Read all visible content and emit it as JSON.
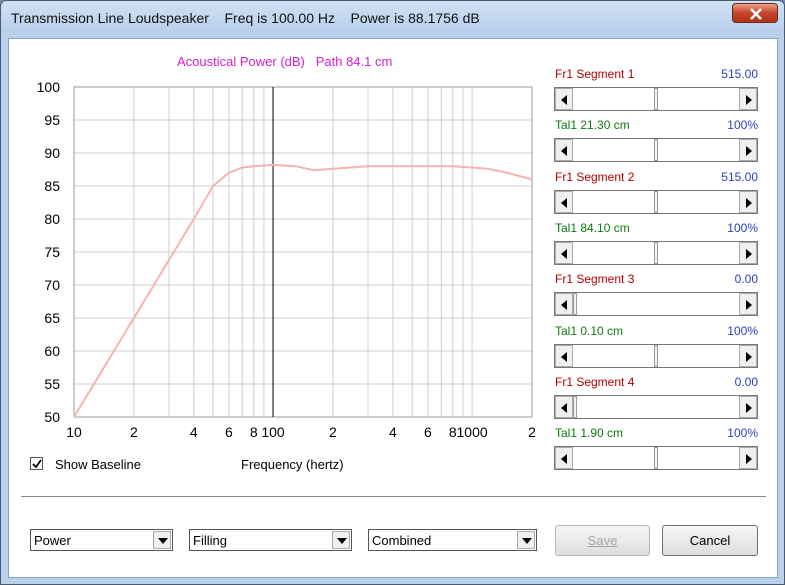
{
  "window": {
    "title": "Transmission Line Loudspeaker    Freq is 100.00 Hz    Power is 88.1756 dB"
  },
  "chart_title": "Acoustical Power (dB)   Path 84.1 cm",
  "chart_data": {
    "type": "line",
    "title": "Acoustical Power (dB)   Path 84.1 cm",
    "xlabel": "Frequency (hertz)",
    "ylabel": "",
    "x_scale": "log",
    "xlim": [
      10,
      2000
    ],
    "ylim": [
      50,
      100
    ],
    "y_ticks": [
      "100",
      "95",
      "90",
      "85",
      "80",
      "75",
      "70",
      "65",
      "60",
      "55",
      "50"
    ],
    "x_ticks": [
      "10",
      "2",
      "4",
      "6",
      "8",
      "100",
      "2",
      "4",
      "6",
      "8",
      "1000",
      "2"
    ],
    "grid": true,
    "cursor_x": 100,
    "series": [
      {
        "color": "#f4b4b0",
        "x": [
          10,
          20,
          40,
          50,
          60,
          70,
          80,
          100,
          130,
          160,
          200,
          300,
          400,
          600,
          800,
          1000,
          1200,
          1500,
          2000
        ],
        "y": [
          50,
          65,
          80,
          85,
          87,
          87.8,
          88,
          88.2,
          88,
          87.4,
          87.6,
          88,
          88,
          88,
          88,
          87.8,
          87.6,
          87,
          86
        ]
      }
    ]
  },
  "show_baseline": {
    "label": "Show Baseline",
    "checked": true
  },
  "x_axis_title": "Frequency (hertz)",
  "segments": [
    {
      "label": "Fr1  Segment 1",
      "value": "515.00",
      "color": "red",
      "thumb": 0.5
    },
    {
      "label": "Tal1  21.30 cm",
      "value": "100%",
      "color": "green",
      "thumb": 0.5
    },
    {
      "label": "Fr1  Segment 2",
      "value": "515.00",
      "color": "red",
      "thumb": 0.5
    },
    {
      "label": "Tal1  84.10 cm",
      "value": "100%",
      "color": "green",
      "thumb": 0.5
    },
    {
      "label": "Fr1  Segment 3",
      "value": "0.00",
      "color": "red",
      "thumb": 0
    },
    {
      "label": "Tal1  0.10 cm",
      "value": "100%",
      "color": "green",
      "thumb": 0.5
    },
    {
      "label": "Fr1  Segment 4",
      "value": "0.00",
      "color": "red",
      "thumb": 0
    },
    {
      "label": "Tal1  1.90 cm",
      "value": "100%",
      "color": "green",
      "thumb": 0.5
    }
  ],
  "combos": {
    "mode": "Power",
    "fill": "Filling",
    "type": "Combined"
  },
  "buttons": {
    "save": "Save",
    "cancel": "Cancel"
  }
}
